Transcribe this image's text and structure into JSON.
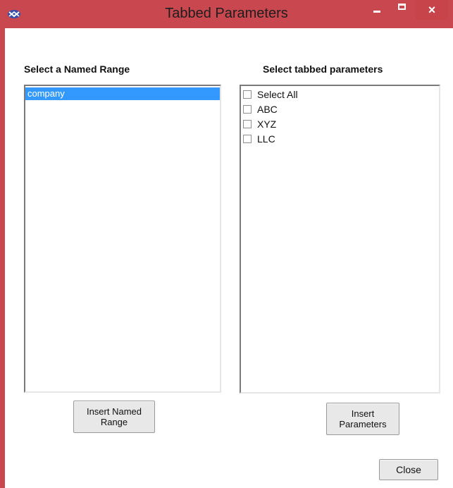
{
  "window": {
    "title": "Tabbed Parameters",
    "icon": "app-logo-icon",
    "controls": {
      "minimize": "minimize-icon",
      "maximize": "maximize-icon",
      "close": "×"
    },
    "accent_color": "#c9474e"
  },
  "left_panel": {
    "heading": "Select a Named Range",
    "items": [
      "company"
    ],
    "selected_index": 0,
    "button_label": "Insert Named\nRange"
  },
  "right_panel": {
    "heading": "Select tabbed parameters",
    "items": [
      {
        "label": "Select All",
        "checked": false
      },
      {
        "label": "ABC",
        "checked": false
      },
      {
        "label": "XYZ",
        "checked": false
      },
      {
        "label": "LLC",
        "checked": false
      }
    ],
    "button_label": "Insert\nParameters"
  },
  "footer": {
    "close_label": "Close"
  },
  "selection_color": "#3399ff"
}
